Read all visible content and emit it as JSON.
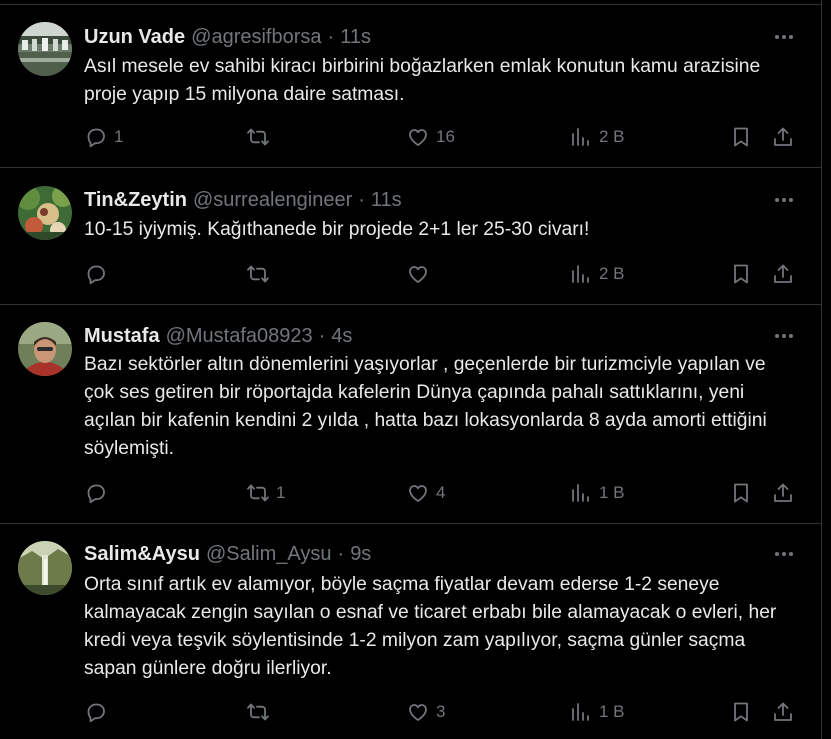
{
  "tweets": [
    {
      "name": "Uzun Vade",
      "handle": "@agresifborsa",
      "time": "11s",
      "body": "Asıl mesele ev sahibi kiracı birbirini boğazlarken emlak konutun kamu arazisine proje yapıp 15 milyona daire satması.",
      "replies": "1",
      "retweets": "",
      "likes": "16",
      "views": "2 B"
    },
    {
      "name": "Tin&Zeytin",
      "handle": "@surrealengineer",
      "time": "11s",
      "body": "10-15 iyiymiş. Kağıthanede bir projede 2+1 ler 25-30 civarı!",
      "replies": "",
      "retweets": "",
      "likes": "",
      "views": "2 B"
    },
    {
      "name": "Mustafa",
      "handle": "@Mustafa08923",
      "time": "4s",
      "body": "Bazı sektörler altın dönemlerini yaşıyorlar , geçenlerde bir turizmciyle yapılan ve çok ses getiren bir röportajda kafelerin Dünya çapında pahalı sattıklarını, yeni açılan bir kafenin kendini 2 yılda , hatta bazı lokasyonlarda 8 ayda amorti ettiğini söylemişti.",
      "replies": "",
      "retweets": "1",
      "likes": "4",
      "views": "1 B"
    },
    {
      "name": "Salim&Aysu",
      "handle": "@Salim_Aysu",
      "time": "9s",
      "body": "Orta sınıf artık ev alamıyor, böyle saçma fiyatlar devam ederse 1-2 seneye kalmayacak zengin sayılan o esnaf ve ticaret erbabı bile alamayacak o evleri, her kredi veya teşvik söylentisinde 1-2 milyon zam yapılıyor, saçma günler saçma sapan günlere doğru ilerliyor.",
      "replies": "",
      "retweets": "",
      "likes": "3",
      "views": "1 B"
    }
  ]
}
